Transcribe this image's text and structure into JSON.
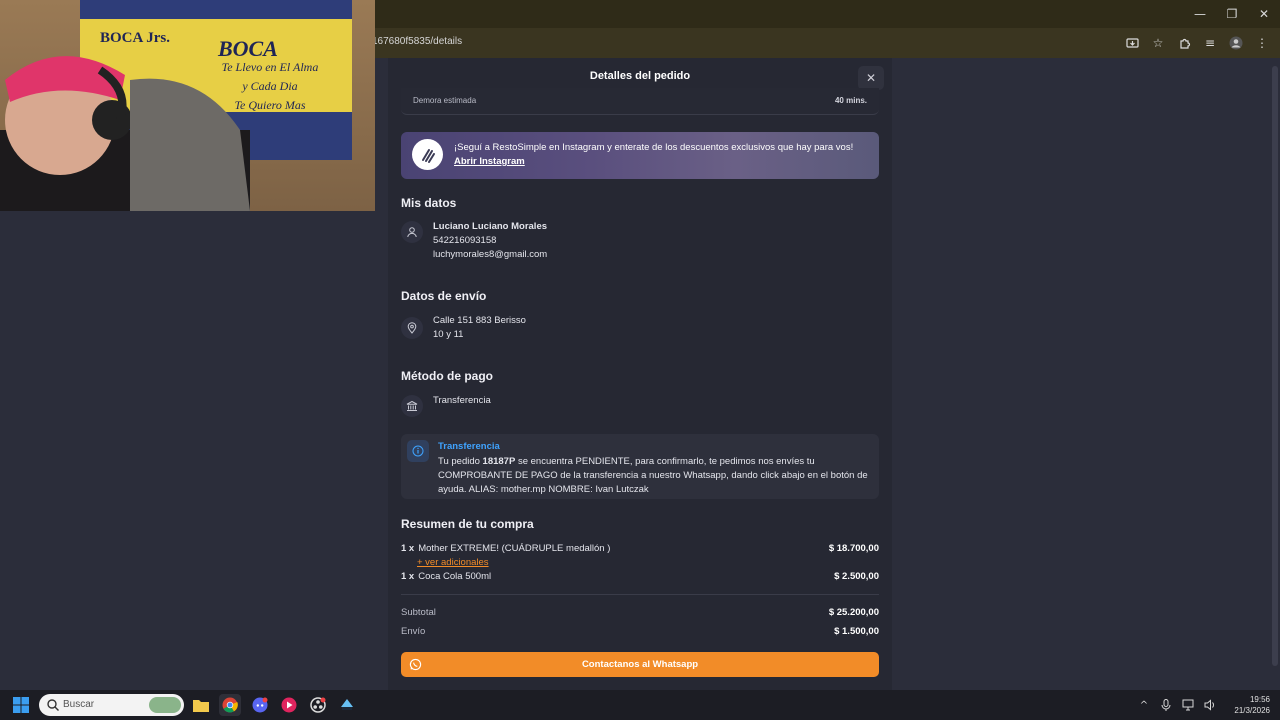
{
  "browser": {
    "url": "167680f5835/details",
    "window_controls": {
      "minimize": "—",
      "maximize": "❐",
      "close": "✕"
    }
  },
  "modal": {
    "title": "Detalles del pedido",
    "close_label": "✕",
    "delay": {
      "label": "Demora estimada",
      "value": "40 mins."
    },
    "banner": {
      "text": "¡Seguí a RestoSimple en Instagram y enterate de los descuentos exclusivos que hay para vos!",
      "link": "Abrir Instagram"
    },
    "my_data": {
      "title": "Mis datos",
      "name": "Luciano Luciano Morales",
      "phone": "542216093158",
      "email": "luchymorales8@gmail.com"
    },
    "shipping": {
      "title": "Datos de envío",
      "address": "Calle 151 883 Berisso",
      "between": "10 y 11"
    },
    "payment": {
      "title": "Método de pago",
      "method": "Transferencia"
    },
    "notice": {
      "title": "Transferencia",
      "text_before": "Tu pedido ",
      "order_id": "18187P",
      "text_after": " se encuentra PENDIENTE, para confirmarlo, te pedimos nos envíes tu COMPROBANTE DE PAGO de la transferencia a nuestro Whatsapp, dando click abajo en el botón de ayuda. ALIAS: mother.mp NOMBRE: Ivan Lutczak"
    },
    "summary": {
      "title": "Resumen de tu compra",
      "items": [
        {
          "qty": "1 x",
          "name": "Mother EXTREME! (CUÁDRUPLE medallón )",
          "price": "$ 18.700,00",
          "extras": "+ ver adicionales"
        },
        {
          "qty": "1 x",
          "name": "Coca Cola 500ml",
          "price": "$ 2.500,00"
        }
      ],
      "subtotal_label": "Subtotal",
      "subtotal_value": "$ 25.200,00",
      "shipping_label": "Envío",
      "shipping_value": "$ 1.500,00"
    },
    "whatsapp_button": "Contactanos al Whatsapp"
  },
  "webcam": {
    "flag_title": "BOCA",
    "flag_subtitle": "BOCA Jrs.",
    "flag_lines": [
      "Te Llevo en El Alma",
      "y Cada Dia",
      "Te Quiero Mas"
    ]
  },
  "taskbar": {
    "search_placeholder": "Buscar",
    "time": "19:56",
    "date": "21/3/2026"
  },
  "colors": {
    "accent_orange": "#f28c28",
    "link_blue": "#3fa3ff",
    "page_bg": "#2b2d3a"
  }
}
